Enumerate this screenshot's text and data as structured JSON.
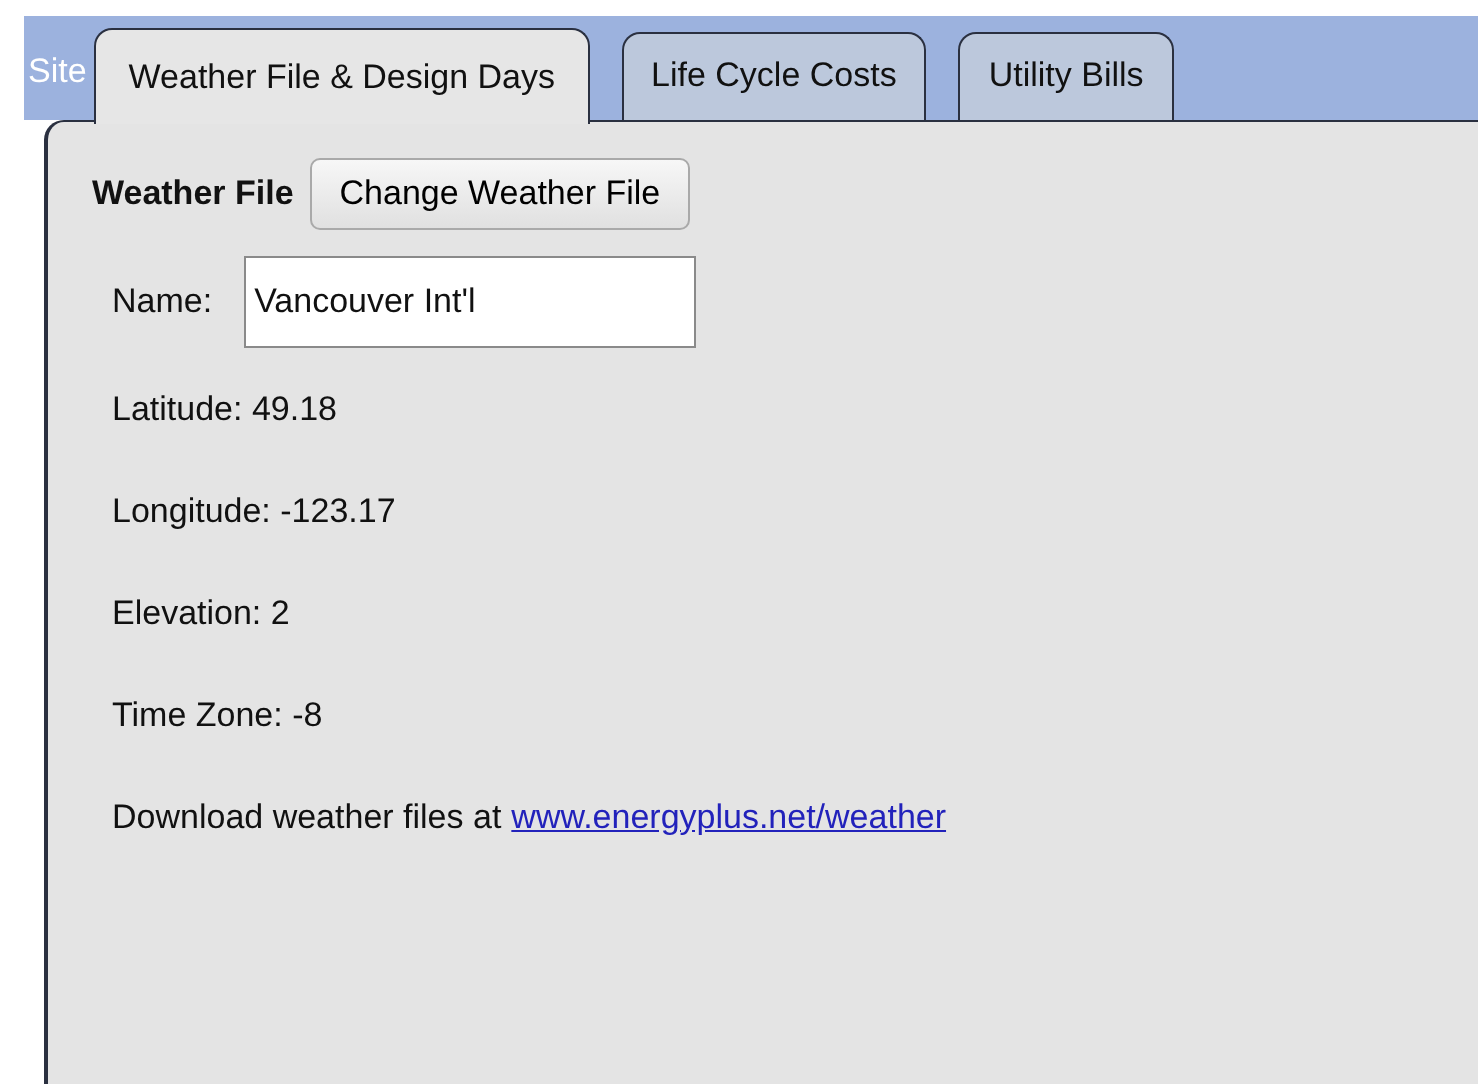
{
  "tabs": [
    {
      "label": "Site",
      "selected": false,
      "kind": "cut"
    },
    {
      "label": "Weather File & Design Days",
      "selected": true,
      "kind": "tab"
    },
    {
      "label": "Life Cycle Costs",
      "selected": false,
      "kind": "tab"
    },
    {
      "label": "Utility Bills",
      "selected": false,
      "kind": "tab"
    }
  ],
  "weather_file": {
    "heading": "Weather File",
    "button": "Change Weather File",
    "name_label": "Name:",
    "name_value": "Vancouver Int'l"
  },
  "info": [
    "Latitude: 49.18",
    "Longitude: -123.17",
    "Elevation: 2",
    "Time Zone: -8"
  ],
  "download": {
    "text": "Download weather files at",
    "link": "www.energyplus.net/weather"
  }
}
